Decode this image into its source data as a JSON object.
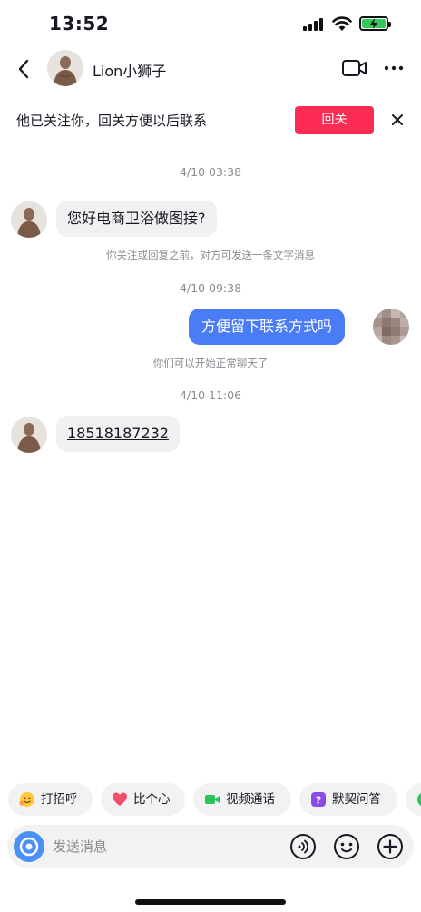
{
  "status_bar": {
    "time": "13:52"
  },
  "header": {
    "contact_name": "Lion小狮子"
  },
  "follow_banner": {
    "text": "他已关注你，回关方便以后联系",
    "button_label": "回关"
  },
  "messages": [
    {
      "timestamp": "4/10 03:38",
      "direction": "in",
      "text": "您好电商卫浴做图接?",
      "notice": "你关注或回复之前，对方可发送一条文字消息"
    },
    {
      "timestamp": "4/10 09:38",
      "direction": "out",
      "text": "方便留下联系方式吗",
      "notice": "你们可以开始正常聊天了"
    },
    {
      "timestamp": "4/10 11:06",
      "direction": "in",
      "text": "18518187232"
    }
  ],
  "quick_replies": [
    {
      "label": "打招呼",
      "icon": "wave-emoji-icon"
    },
    {
      "label": "比个心",
      "icon": "heart-icon"
    },
    {
      "label": "视频通话",
      "icon": "video-call-icon"
    },
    {
      "label": "默契问答",
      "icon": "question-icon"
    }
  ],
  "input": {
    "placeholder": "发送消息"
  },
  "colors": {
    "accent_red": "#fe2c55",
    "bubble_out": "#4a7cf6",
    "bubble_in": "#f1f1f2",
    "camera_blue": "#4a90f7"
  }
}
